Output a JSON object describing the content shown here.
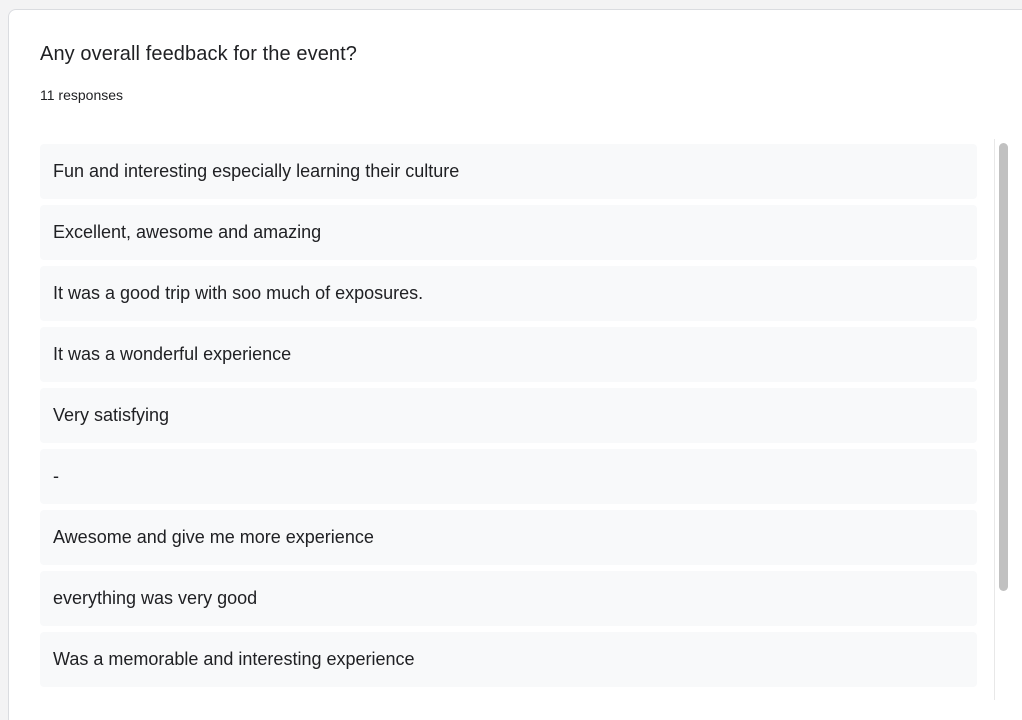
{
  "question": {
    "title": "Any overall feedback for the event?",
    "response_count": "11 responses"
  },
  "responses": [
    "Fun and interesting especially learning their culture",
    "Excellent, awesome and amazing",
    "It was a good trip with soo much of exposures.",
    "It was a wonderful experience",
    "Very satisfying",
    "-",
    "Awesome and give me more experience",
    "everything was very good",
    "Was a memorable and interesting experience"
  ],
  "colors": {
    "card_background": "#ffffff",
    "card_border": "#dadce0",
    "response_background": "#f8f9fa",
    "text": "#202124",
    "scrollbar_thumb": "#c1c1c1"
  }
}
